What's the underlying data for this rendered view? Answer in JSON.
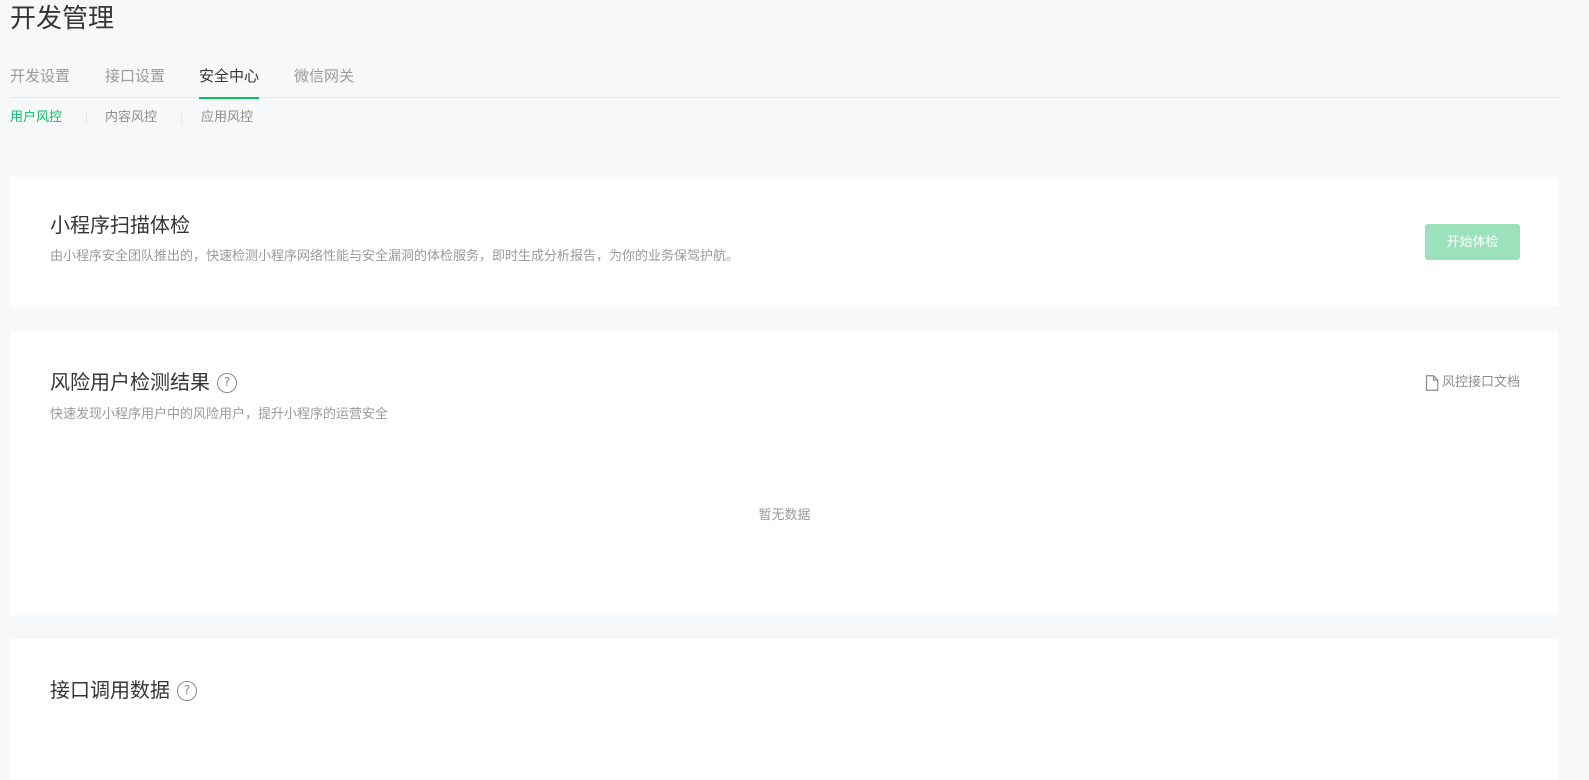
{
  "page": {
    "title": "开发管理"
  },
  "tabs": [
    {
      "label": "开发设置",
      "active": false
    },
    {
      "label": "接口设置",
      "active": false
    },
    {
      "label": "安全中心",
      "active": true
    },
    {
      "label": "微信网关",
      "active": false
    }
  ],
  "subtabs": [
    {
      "label": "用户风控",
      "active": true
    },
    {
      "label": "内容风控",
      "active": false
    },
    {
      "label": "应用风控",
      "active": false
    }
  ],
  "scan_card": {
    "title": "小程序扫描体检",
    "description": "由小程序安全团队推出的，快速检测小程序网络性能与安全漏洞的体检服务，即时生成分析报告，为你的业务保驾护航。",
    "button_label": "开始体检"
  },
  "risk_card": {
    "title": "风险用户检测结果",
    "help_icon": "question-circle-icon",
    "description": "快速发现小程序用户中的风险用户，提升小程序的运营安全",
    "doc_link_label": "风控接口文档",
    "doc_icon": "document-icon",
    "empty_text": "暂无数据"
  },
  "api_card": {
    "title": "接口调用数据",
    "help_icon": "question-circle-icon"
  },
  "colors": {
    "accent": "#07c160",
    "button_disabled": "#9be2bc",
    "background": "#f7f8fa"
  }
}
